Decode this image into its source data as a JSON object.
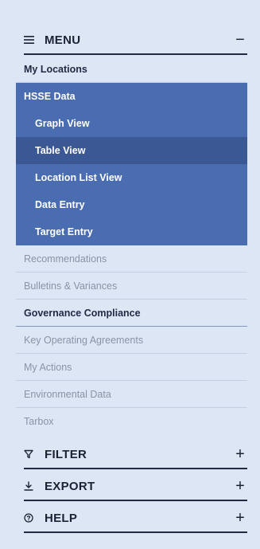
{
  "menu": {
    "title": "MENU",
    "toggle": "−",
    "items": [
      {
        "label": "My Locations"
      },
      {
        "label": "HSSE Data"
      },
      {
        "label": "Graph View"
      },
      {
        "label": "Table View"
      },
      {
        "label": "Location List View"
      },
      {
        "label": "Data Entry"
      },
      {
        "label": "Target Entry"
      },
      {
        "label": "Recommendations"
      },
      {
        "label": "Bulletins & Variances"
      },
      {
        "label": "Governance Compliance"
      },
      {
        "label": "Key Operating Agreements"
      },
      {
        "label": "My Actions"
      },
      {
        "label": "Environmental Data"
      },
      {
        "label": "Tarbox"
      }
    ]
  },
  "filter": {
    "title": "FILTER",
    "toggle": "+"
  },
  "export": {
    "title": "EXPORT",
    "toggle": "+"
  },
  "help": {
    "title": "HELP",
    "toggle": "+"
  },
  "colors": {
    "background": "#dde6f5",
    "active_group": "#4a6cb0",
    "active_current": "#3c5894",
    "text_dark": "#1f2a44",
    "text_muted": "#8a93a6"
  }
}
